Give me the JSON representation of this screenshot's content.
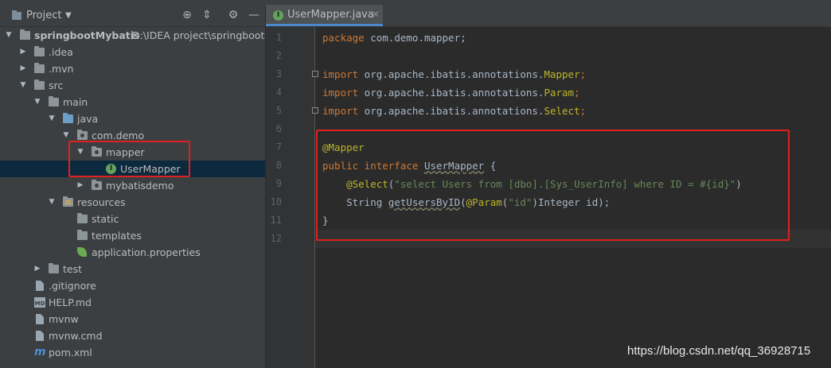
{
  "panel": {
    "title": "Project",
    "tree": [
      {
        "label": "springbootMybatis",
        "path": "D:\\IDEA project\\springbootM",
        "icon": "project-folder-icon"
      },
      {
        "label": ".idea",
        "icon": "folder-icon"
      },
      {
        "label": ".mvn",
        "icon": "folder-icon"
      },
      {
        "label": "src",
        "icon": "folder-icon"
      },
      {
        "label": "main",
        "icon": "folder-icon"
      },
      {
        "label": "java",
        "icon": "source-folder-icon"
      },
      {
        "label": "com.demo",
        "icon": "package-icon"
      },
      {
        "label": "mapper",
        "icon": "package-icon"
      },
      {
        "label": "UserMapper",
        "icon": "interface-icon"
      },
      {
        "label": "mybatisdemo",
        "icon": "package-icon"
      },
      {
        "label": "resources",
        "icon": "resources-folder-icon"
      },
      {
        "label": "static",
        "icon": "folder-icon"
      },
      {
        "label": "templates",
        "icon": "folder-icon"
      },
      {
        "label": "application.properties",
        "icon": "spring-leaf-icon"
      },
      {
        "label": "test",
        "icon": "folder-icon"
      },
      {
        "label": ".gitignore",
        "icon": "file-icon"
      },
      {
        "label": "HELP.md",
        "icon": "markdown-icon"
      },
      {
        "label": "mvnw",
        "icon": "file-icon"
      },
      {
        "label": "mvnw.cmd",
        "icon": "file-icon"
      },
      {
        "label": "pom.xml",
        "icon": "maven-icon"
      }
    ]
  },
  "editor": {
    "tab": {
      "label": "UserMapper.java",
      "icon_letter": "I"
    },
    "line_numbers": [
      "1",
      "2",
      "3",
      "4",
      "5",
      "6",
      "7",
      "8",
      "9",
      "10",
      "11",
      "12"
    ],
    "code": {
      "l1_kw": "package",
      "l1_rest": " com.demo.mapper;",
      "l3_kw": "import",
      "l3_pkg": " org.apache.ibatis.annotations.",
      "l3_cls": "Mapper",
      "l4_cls": "Param",
      "l5_cls": "Select",
      "l7_ann": "@Mapper",
      "l8_kw": "public interface",
      "l8_name": "UserMapper",
      "l8_rest": " {",
      "l9_ann": "@Select",
      "l9_str": "\"select Users from [dbo].[Sys_UserInfo] where ID = #{id}\"",
      "l10_type": "String",
      "l10_method": "getUsersByID",
      "l10_ann": "@Param",
      "l10_str": "\"id\"",
      "l10_rest": "Integer id);",
      "l11": "}"
    }
  },
  "watermark": "https://blog.csdn.net/qq_36928715",
  "colors": {
    "keyword": "#cc7832",
    "annotation": "#bbb529",
    "string": "#6a8759",
    "highlight_box": "#e02020"
  }
}
